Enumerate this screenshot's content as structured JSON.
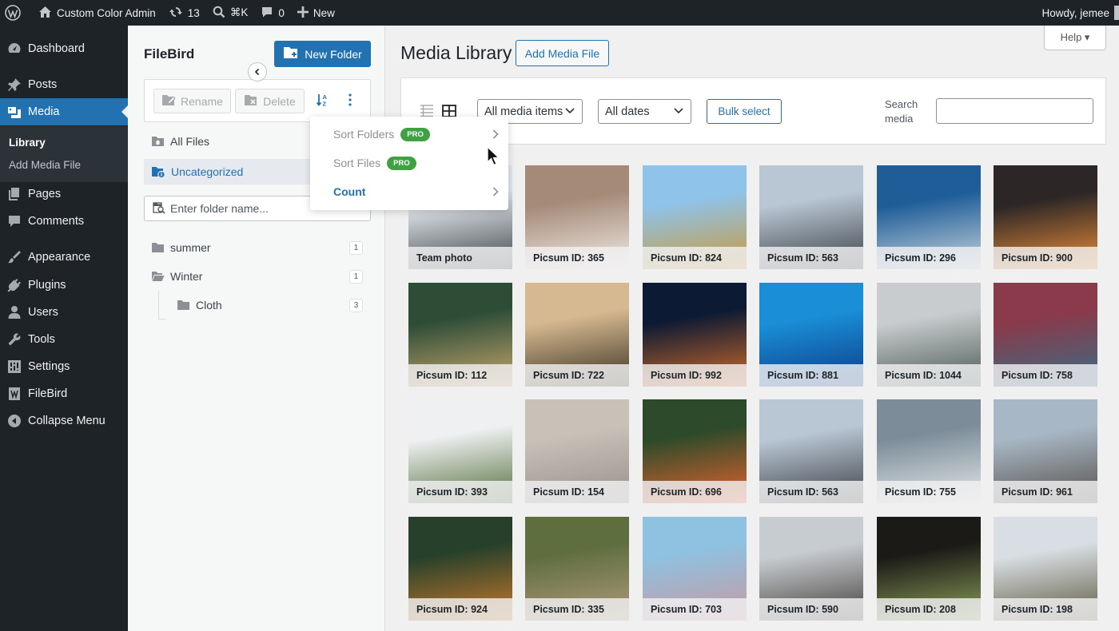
{
  "adminbar": {
    "site_name": "Custom Color Admin",
    "updates_count": "13",
    "search_shortcut": "⌘K",
    "comments_count": "0",
    "new_label": "New",
    "greeting": "Howdy, jemee"
  },
  "sidebar": {
    "items": [
      {
        "label": "Dashboard",
        "icon": "dashboard-icon"
      },
      {
        "label": "Posts",
        "icon": "pin-icon"
      },
      {
        "label": "Media",
        "icon": "media-icon"
      },
      {
        "label": "Pages",
        "icon": "page-icon"
      },
      {
        "label": "Comments",
        "icon": "comment-icon"
      },
      {
        "label": "Appearance",
        "icon": "brush-icon"
      },
      {
        "label": "Plugins",
        "icon": "plug-icon"
      },
      {
        "label": "Users",
        "icon": "user-icon"
      },
      {
        "label": "Tools",
        "icon": "wrench-icon"
      },
      {
        "label": "Settings",
        "icon": "settings-icon"
      },
      {
        "label": "FileBird",
        "icon": "filebird-icon"
      },
      {
        "label": "Collapse Menu",
        "icon": "collapse-icon"
      }
    ],
    "submenu": {
      "library": "Library",
      "add_media_file": "Add Media File"
    }
  },
  "filebird": {
    "title": "FileBird",
    "new_folder": "New Folder",
    "rename": "Rename",
    "delete": "Delete",
    "all_files": "All Files",
    "uncategorized": "Uncategorized",
    "search_placeholder": "Enter folder name...",
    "folders": [
      {
        "name": "summer",
        "count": "1"
      },
      {
        "name": "Winter",
        "count": "1"
      },
      {
        "name": "Cloth",
        "count": "3"
      }
    ]
  },
  "sort_menu": {
    "sort_folders": "Sort Folders",
    "sort_files": "Sort Files",
    "pro": "PRO",
    "count": "Count"
  },
  "main": {
    "help": "Help ▾",
    "title": "Media Library",
    "add_media_file": "Add Media File",
    "filter_media": "All media items",
    "filter_dates": "All dates",
    "bulk_select": "Bulk select",
    "search_label": "Search media"
  },
  "media": [
    {
      "caption": "Team photo",
      "c1": "#dfe5ea",
      "c2": "#3f4448"
    },
    {
      "caption": "Picsum ID: 365",
      "c1": "#a58a78",
      "c2": "#f2ece6"
    },
    {
      "caption": "Picsum ID: 824",
      "c1": "#8fc3ea",
      "c2": "#c99a3c"
    },
    {
      "caption": "Picsum ID: 563",
      "c1": "#b9c6d3",
      "c2": "#3c4147"
    },
    {
      "caption": "Picsum ID: 296",
      "c1": "#1e5d98",
      "c2": "#c9d5dc"
    },
    {
      "caption": "Picsum ID: 900",
      "c1": "#2c2626",
      "c2": "#ee8f3a"
    },
    {
      "caption": "Picsum ID: 112",
      "c1": "#2d4d37",
      "c2": "#c9a86e"
    },
    {
      "caption": "Picsum ID: 722",
      "c1": "#d6b991",
      "c2": "#3a3221"
    },
    {
      "caption": "Picsum ID: 992",
      "c1": "#0d1a33",
      "c2": "#d36d2a"
    },
    {
      "caption": "Picsum ID: 881",
      "c1": "#1a8fd8",
      "c2": "#0c3d86"
    },
    {
      "caption": "Picsum ID: 1044",
      "c1": "#c8ccce",
      "c2": "#4b5a55"
    },
    {
      "caption": "Picsum ID: 758",
      "c1": "#8a3a4a",
      "c2": "#3a6c84"
    },
    {
      "caption": "Picsum ID: 393",
      "c1": "#eef0f2",
      "c2": "#536f3a"
    },
    {
      "caption": "Picsum ID: 154",
      "c1": "#c9c1b8",
      "c2": "#978f8a"
    },
    {
      "caption": "Picsum ID: 696",
      "c1": "#2d4a2a",
      "c2": "#e6642f"
    },
    {
      "caption": "Picsum ID: 563",
      "c1": "#b9c6d3",
      "c2": "#3c4147"
    },
    {
      "caption": "Picsum ID: 755",
      "c1": "#7c8d99",
      "c2": "#e6e8ea"
    },
    {
      "caption": "Picsum ID: 961",
      "c1": "#a8b7c5",
      "c2": "#57514b"
    },
    {
      "caption": "Picsum ID: 924",
      "c1": "#27402b",
      "c2": "#c87a2c"
    },
    {
      "caption": "Picsum ID: 335",
      "c1": "#5f6e3f",
      "c2": "#b29a7d"
    },
    {
      "caption": "Picsum ID: 703",
      "c1": "#8fc1e0",
      "c2": "#c79aa2"
    },
    {
      "caption": "Picsum ID: 590",
      "c1": "#c7ccd1",
      "c2": "#45403b"
    },
    {
      "caption": "Picsum ID: 208",
      "c1": "#1c1a17",
      "c2": "#8ca15a"
    },
    {
      "caption": "Picsum ID: 198",
      "c1": "#d8dee3",
      "c2": "#5f5a42"
    }
  ],
  "colors": {
    "accent": "#2271b1",
    "admin_dark": "#1d2327",
    "pro_badge": "#3ea142"
  }
}
